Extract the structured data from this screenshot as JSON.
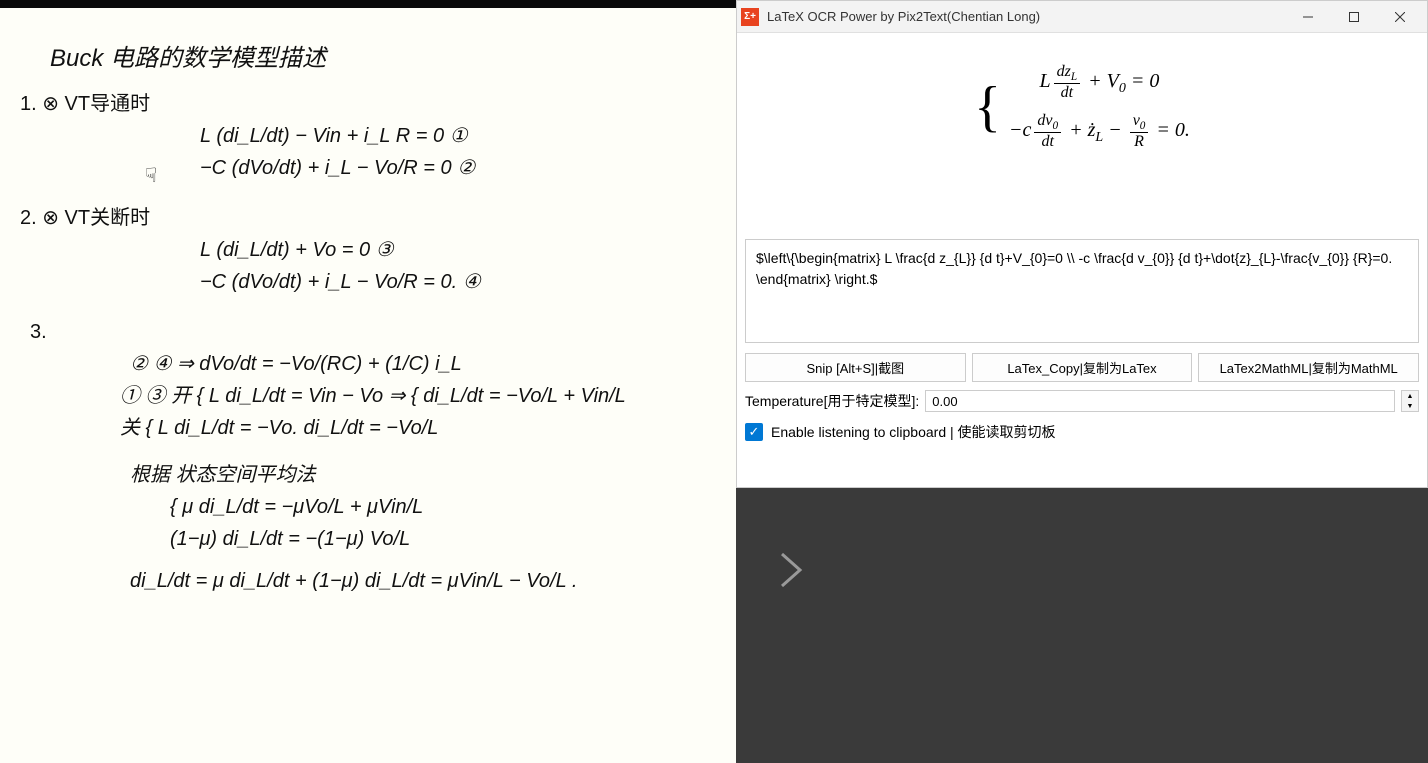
{
  "window": {
    "title": "LaTeX OCR Power by Pix2Text(Chentian Long)",
    "icon_text": "Σ+"
  },
  "math_preview": {
    "row1": "L(dz_L/dt) + V₀ = 0",
    "row2": "−c(dv₀/dt) + ż_L − v₀/R = 0."
  },
  "latex_source": "$\\left\\{\\begin{matrix} L \\frac{d z_{L}} {d t}+V_{0}=0 \\\\ -c \\frac{d v_{0}} {d t}+\\dot{z}_{L}-\\frac{v_{0}} {R}=0. \\end{matrix} \\right.$",
  "buttons": {
    "snip": "Snip [Alt+S]|截图",
    "latex_copy": "LaTex_Copy|复制为LaTex",
    "mathml": "LaTex2MathML|复制为MathML"
  },
  "temperature": {
    "label": "Temperature[用于特定模型]:",
    "value": "0.00"
  },
  "checkbox": {
    "label": "Enable listening to clipboard | 使能读取剪切板",
    "checked": true
  },
  "notes": {
    "title": "Buck 电路的数学模型描述",
    "section1_label": "1. ⊗ VT导通时",
    "s1_eq1": "L (di_L/dt) − Vin + i_L R = 0    ①",
    "s1_eq2": "−C (dVo/dt) + i_L − Vo/R = 0    ②",
    "section2_label": "2. ⊗ VT关断时",
    "s2_eq1": "L (di_L/dt) + Vo = 0    ③",
    "s2_eq2": "−C (dVo/dt) + i_L − Vo/R = 0.    ④",
    "section3_label": "3.",
    "s3_line1": "② ④ ⇒  dVo/dt = −Vo/(RC) + (1/C) i_L",
    "s3_line2": "① ③  开 { L di_L/dt = Vin − Vo    ⇒  { di_L/dt = −Vo/L + Vin/L",
    "s3_line3": "     关 { L di_L/dt = −Vo.            di_L/dt  =  −Vo/L",
    "s3_line4": "根据 状态空间平均法",
    "s3_line5": "{ μ di_L/dt = −μVo/L + μVin/L",
    "s3_line6": "  (1−μ) di_L/dt  =  −(1−μ) Vo/L",
    "s3_line7": "di_L/dt = μ di_L/dt + (1−μ) di_L/dt = μVin/L − Vo/L ."
  }
}
